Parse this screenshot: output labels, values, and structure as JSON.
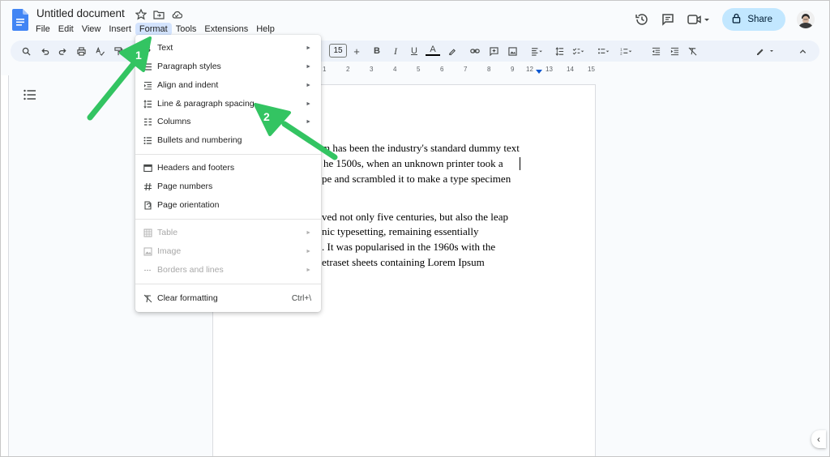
{
  "document": {
    "title": "Untitled document",
    "paragraph1": [
      "m has been the industry's standard dummy text",
      "he 1500s, when an unknown printer took a",
      "pe and scrambled it to make a type specimen"
    ],
    "paragraph2": [
      "ved not only five centuries, but also the leap",
      "nic typesetting, remaining essentially",
      ". It was popularised in the 1960s with the",
      "etraset sheets containing Lorem Ipsum"
    ]
  },
  "menubar": [
    "File",
    "Edit",
    "View",
    "Insert",
    "Format",
    "Tools",
    "Extensions",
    "Help"
  ],
  "active_menu": "Format",
  "share": {
    "label": "Share"
  },
  "toolbar": {
    "font_size": "15"
  },
  "ruler_ticks": [
    "1",
    "2",
    "3",
    "4",
    "5",
    "6",
    "7",
    "8",
    "9",
    "10",
    "11",
    "12",
    "13",
    "14",
    "15"
  ],
  "format_menu": {
    "group1": [
      {
        "label": "Text",
        "submenu": true,
        "icon": "bold-icon"
      },
      {
        "label": "Paragraph styles",
        "submenu": true,
        "icon": "paragraph-styles-icon"
      },
      {
        "label": "Align and indent",
        "submenu": true,
        "icon": "indent-icon"
      },
      {
        "label": "Line & paragraph spacing",
        "submenu": true,
        "icon": "line-spacing-icon"
      },
      {
        "label": "Columns",
        "submenu": true,
        "icon": "columns-icon"
      },
      {
        "label": "Bullets and numbering",
        "submenu": false,
        "icon": "bullets-icon"
      }
    ],
    "group2": [
      {
        "label": "Headers and footers",
        "icon": "header-footer-icon"
      },
      {
        "label": "Page numbers",
        "icon": "hash-icon"
      },
      {
        "label": "Page orientation",
        "icon": "page-orientation-icon"
      }
    ],
    "group3": [
      {
        "label": "Table",
        "disabled": true,
        "icon": "table-icon"
      },
      {
        "label": "Image",
        "disabled": true,
        "icon": "image-icon"
      },
      {
        "label": "Borders and lines",
        "disabled": true,
        "icon": "borders-icon"
      }
    ],
    "group4": [
      {
        "label": "Clear formatting",
        "shortcut": "Ctrl+\\",
        "icon": "clear-format-icon"
      }
    ]
  },
  "annotations": [
    {
      "number": "1"
    },
    {
      "number": "2"
    }
  ],
  "colors": {
    "accent": "#0b57d0",
    "share_bg": "#c2e7ff",
    "toolbar_bg": "#edf2fa",
    "annotation_green": "#33c462"
  }
}
